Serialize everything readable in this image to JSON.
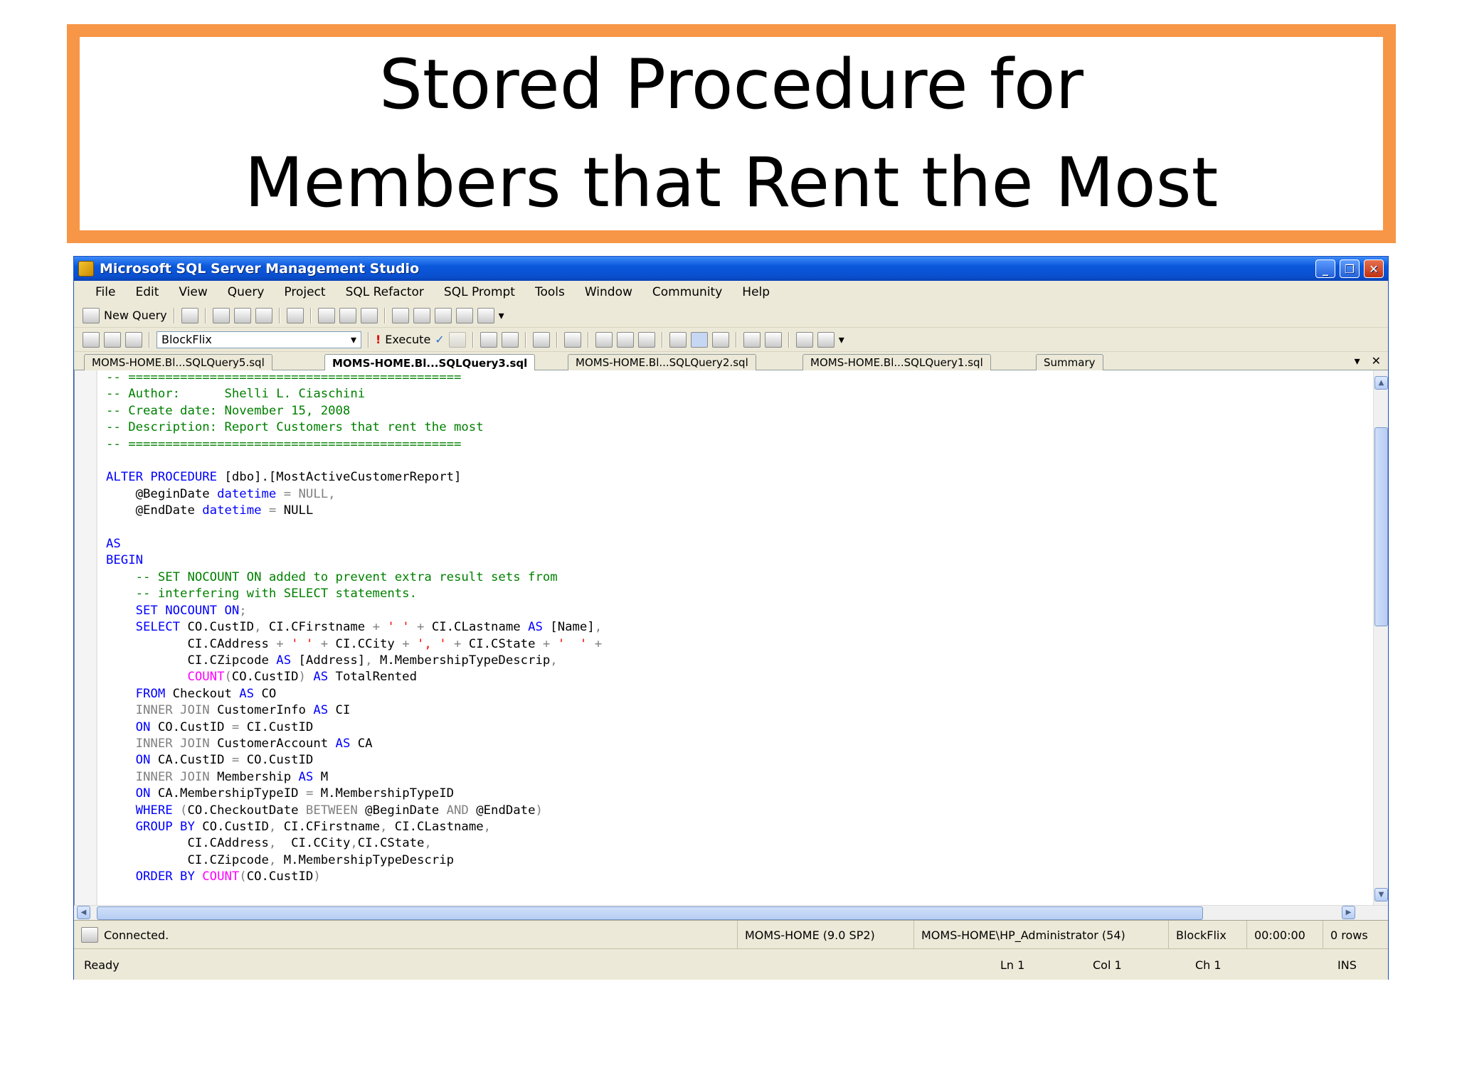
{
  "slide": {
    "title_line1": "Stored Procedure for",
    "title_line2": "Members that Rent the Most"
  },
  "window": {
    "title": "Microsoft SQL Server Management Studio",
    "minimize": "_",
    "maximize": "❐",
    "close": "✕"
  },
  "menu": [
    "File",
    "Edit",
    "View",
    "Query",
    "Project",
    "SQL Refactor",
    "SQL Prompt",
    "Tools",
    "Window",
    "Community",
    "Help"
  ],
  "toolbar": {
    "new_query": "New Query",
    "database": "BlockFlix",
    "execute": "Execute",
    "execute_icon": "!",
    "check_icon": "✓",
    "dropdown_arrow": "▾"
  },
  "tabs": [
    {
      "label": "MOMS-HOME.Bl...SQLQuery5.sql",
      "active": false
    },
    {
      "label": "MOMS-HOME.Bl...SQLQuery3.sql",
      "active": true
    },
    {
      "label": "MOMS-HOME.Bl...SQLQuery2.sql",
      "active": false
    },
    {
      "label": "MOMS-HOME.Bl...SQLQuery1.sql",
      "active": false
    },
    {
      "label": "Summary",
      "active": false
    }
  ],
  "tab_controls": {
    "dropdown": "▾",
    "close": "✕"
  },
  "code_lines": [
    [
      [
        "c",
        "-- ============================================="
      ]
    ],
    [
      [
        "c",
        "-- Author:      Shelli L. Ciaschini"
      ]
    ],
    [
      [
        "c",
        "-- Create date: November 15, 2008"
      ]
    ],
    [
      [
        "c",
        "-- Description: Report Customers that rent the most"
      ]
    ],
    [
      [
        "c",
        "-- ============================================="
      ]
    ],
    [
      [
        "t",
        ""
      ]
    ],
    [
      [
        "k",
        "ALTER PROCEDURE"
      ],
      [
        "t",
        " [dbo].[MostActiveCustomerReport]"
      ]
    ],
    [
      [
        "t",
        "    @BeginDate "
      ],
      [
        "k",
        "datetime"
      ],
      [
        "g",
        " = NULL,"
      ]
    ],
    [
      [
        "t",
        "    @EndDate "
      ],
      [
        "k",
        "datetime"
      ],
      [
        "g",
        " = "
      ],
      [
        "t",
        "NULL"
      ]
    ],
    [
      [
        "t",
        ""
      ]
    ],
    [
      [
        "k",
        "AS"
      ]
    ],
    [
      [
        "k",
        "BEGIN"
      ]
    ],
    [
      [
        "c",
        "    -- SET NOCOUNT ON added to prevent extra result sets from"
      ]
    ],
    [
      [
        "c",
        "    -- interfering with SELECT statements."
      ]
    ],
    [
      [
        "k",
        "    SET NOCOUNT ON"
      ],
      [
        "g",
        ";"
      ]
    ],
    [
      [
        "k",
        "    SELECT"
      ],
      [
        "t",
        " CO.CustID"
      ],
      [
        "g",
        ","
      ],
      [
        "t",
        " CI.CFirstname "
      ],
      [
        "g",
        "+ "
      ],
      [
        "r",
        "' '"
      ],
      [
        "g",
        " + "
      ],
      [
        "t",
        "CI.CLastname "
      ],
      [
        "k",
        "AS"
      ],
      [
        "t",
        " [Name]"
      ],
      [
        "g",
        ","
      ]
    ],
    [
      [
        "t",
        "           CI.CAddress "
      ],
      [
        "g",
        "+ "
      ],
      [
        "r",
        "' '"
      ],
      [
        "g",
        " + "
      ],
      [
        "t",
        "CI.CCity "
      ],
      [
        "g",
        "+ "
      ],
      [
        "r",
        "', '"
      ],
      [
        "g",
        " + "
      ],
      [
        "t",
        "CI.CState "
      ],
      [
        "g",
        "+ "
      ],
      [
        "r",
        "'  '"
      ],
      [
        "g",
        " +"
      ]
    ],
    [
      [
        "t",
        "           CI.CZipcode "
      ],
      [
        "k",
        "AS"
      ],
      [
        "t",
        " [Address]"
      ],
      [
        "g",
        ","
      ],
      [
        "t",
        " M.MembershipTypeDescrip"
      ],
      [
        "g",
        ","
      ]
    ],
    [
      [
        "m",
        "           COUNT"
      ],
      [
        "g",
        "("
      ],
      [
        "t",
        "CO.CustID"
      ],
      [
        "g",
        ")"
      ],
      [
        "k",
        " AS"
      ],
      [
        "t",
        " TotalRented"
      ]
    ],
    [
      [
        "k",
        "    FROM"
      ],
      [
        "t",
        " Checkout "
      ],
      [
        "k",
        "AS"
      ],
      [
        "t",
        " CO"
      ]
    ],
    [
      [
        "g",
        "    INNER JOIN"
      ],
      [
        "t",
        " CustomerInfo "
      ],
      [
        "k",
        "AS"
      ],
      [
        "t",
        " CI"
      ]
    ],
    [
      [
        "k",
        "    ON"
      ],
      [
        "t",
        " CO.CustID "
      ],
      [
        "g",
        "="
      ],
      [
        "t",
        " CI.CustID"
      ]
    ],
    [
      [
        "g",
        "    INNER JOIN"
      ],
      [
        "t",
        " CustomerAccount "
      ],
      [
        "k",
        "AS"
      ],
      [
        "t",
        " CA"
      ]
    ],
    [
      [
        "k",
        "    ON"
      ],
      [
        "t",
        " CA.CustID "
      ],
      [
        "g",
        "="
      ],
      [
        "t",
        " CO.CustID"
      ]
    ],
    [
      [
        "g",
        "    INNER JOIN"
      ],
      [
        "t",
        " Membership "
      ],
      [
        "k",
        "AS"
      ],
      [
        "t",
        " M"
      ]
    ],
    [
      [
        "k",
        "    ON"
      ],
      [
        "t",
        " CA.MembershipTypeID "
      ],
      [
        "g",
        "="
      ],
      [
        "t",
        " M.MembershipTypeID"
      ]
    ],
    [
      [
        "k",
        "    WHERE"
      ],
      [
        "g",
        " ("
      ],
      [
        "t",
        "CO.CheckoutDate "
      ],
      [
        "g",
        "BETWEEN"
      ],
      [
        "t",
        " @BeginDate "
      ],
      [
        "g",
        "AND"
      ],
      [
        "t",
        " @EndDate"
      ],
      [
        "g",
        ")"
      ]
    ],
    [
      [
        "k",
        "    GROUP BY"
      ],
      [
        "t",
        " CO.CustID"
      ],
      [
        "g",
        ","
      ],
      [
        "t",
        " CI.CFirstname"
      ],
      [
        "g",
        ","
      ],
      [
        "t",
        " CI.CLastname"
      ],
      [
        "g",
        ","
      ]
    ],
    [
      [
        "t",
        "           CI.CAddress"
      ],
      [
        "g",
        ","
      ],
      [
        "t",
        "  CI.CCity"
      ],
      [
        "g",
        ","
      ],
      [
        "t",
        "CI.CState"
      ],
      [
        "g",
        ","
      ]
    ],
    [
      [
        "t",
        "           CI.CZipcode"
      ],
      [
        "g",
        ","
      ],
      [
        "t",
        " M.MembershipTypeDescrip"
      ]
    ],
    [
      [
        "k",
        "    ORDER BY"
      ],
      [
        "m",
        " COUNT"
      ],
      [
        "g",
        "("
      ],
      [
        "t",
        "CO.CustID"
      ],
      [
        "g",
        ")"
      ]
    ]
  ],
  "status": {
    "connected": "Connected.",
    "server": "MOMS-HOME (9.0 SP2)",
    "user": "MOMS-HOME\\HP_Administrator (54)",
    "database": "BlockFlix",
    "elapsed": "00:00:00",
    "rows": "0 rows"
  },
  "readybar": {
    "ready": "Ready",
    "ln": "Ln 1",
    "col": "Col 1",
    "ch": "Ch 1",
    "ins": "INS"
  },
  "icons": [
    "app-icon",
    "new-query-icon",
    "open-file-icon",
    "save-icon",
    "save-all-icon",
    "execute-icon",
    "parse-check-icon",
    "connect-icon",
    "disconnect-icon",
    "results-to-grid-icon",
    "comment-icon",
    "uncomment-icon",
    "indent-icon",
    "outdent-icon",
    "scroll-up-icon",
    "scroll-down-icon",
    "scroll-left-icon",
    "scroll-right-icon",
    "connected-icon"
  ],
  "colors": {
    "title_border": "#f79646",
    "comment": "#008000",
    "keyword": "#0000ff",
    "string": "#ff0000",
    "function": "#ff00ff",
    "operator": "#808080"
  }
}
